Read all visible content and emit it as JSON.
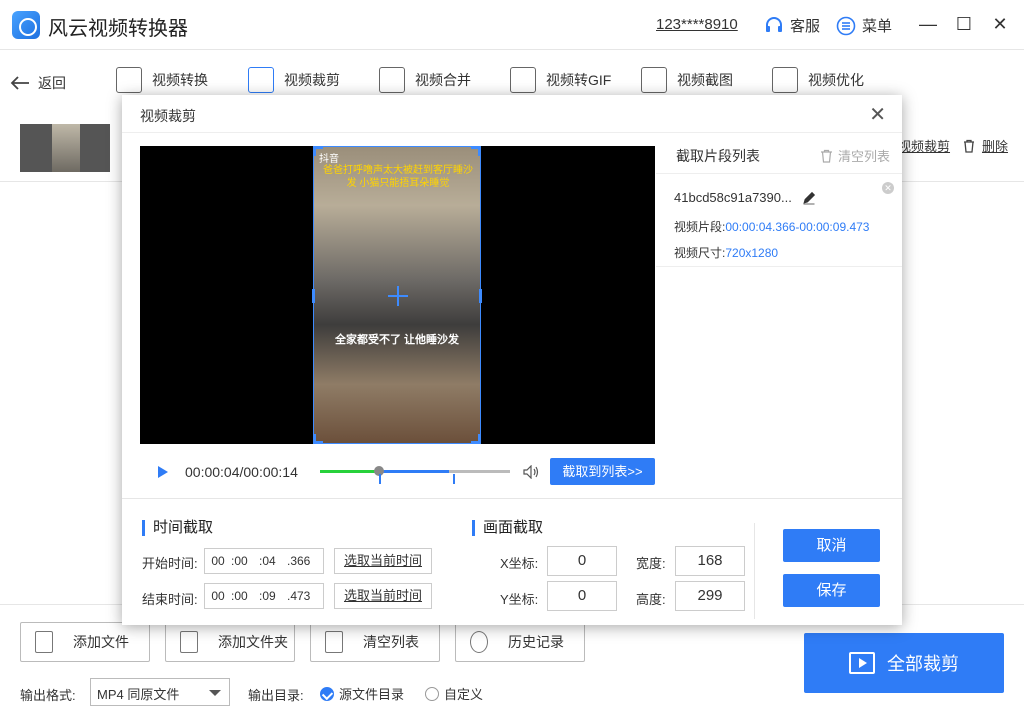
{
  "app": {
    "title": "风云视频转换器",
    "phone": "123****8910",
    "service": "客服",
    "menu": "菜单"
  },
  "toolbar": {
    "back": "返回",
    "tools": [
      "视频转换",
      "视频裁剪",
      "视频合并",
      "视频转GIF",
      "视频截图",
      "视频优化"
    ]
  },
  "file_row": {
    "crop_link": "视频裁剪",
    "delete_link": "删除"
  },
  "modal": {
    "title": "视频裁剪",
    "video": {
      "platform": "抖音",
      "caption_top": "爸爸打呼噜声太大被赶到客厅睡沙发 小猫只能捂耳朵睡觉",
      "caption_mid": "全家都受不了 让他睡沙发",
      "time": "00:00:04/00:00:14",
      "progress": 0.31,
      "sel_start": 0.31,
      "sel_end": 0.68,
      "add_button": "截取到列表>>"
    },
    "list": {
      "title": "截取片段列表",
      "clear": "清空列表",
      "clip": {
        "name": "41bcd58c91a7390...",
        "segment_label": "视频片段:",
        "segment_value": "00:00:04.366-00:00:09.473",
        "size_label": "视频尺寸:",
        "size_value": "720x1280"
      }
    },
    "time_section": {
      "title": "时间截取",
      "start_label": "开始时间:",
      "end_label": "结束时间:",
      "start": [
        "00",
        ":00",
        ":04",
        ".366"
      ],
      "end": [
        "00",
        ":00",
        ":09",
        ".473"
      ],
      "pick_label": "选取当前时间"
    },
    "crop_section": {
      "title": "画面截取",
      "x_label": "X坐标:",
      "y_label": "Y坐标:",
      "w_label": "宽度:",
      "h_label": "高度:",
      "x": "0",
      "y": "0",
      "w": "168",
      "h": "299"
    },
    "cancel": "取消",
    "save": "保存"
  },
  "bottom": {
    "add_file": "添加文件",
    "add_folder": "添加文件夹",
    "clear_list": "清空列表",
    "history": "历史记录",
    "crop_all": "全部裁剪",
    "format_label": "输出格式:",
    "format_value": "MP4 同原文件",
    "dir_label": "输出目录:",
    "dir_source": "源文件目录",
    "dir_custom": "自定义"
  }
}
